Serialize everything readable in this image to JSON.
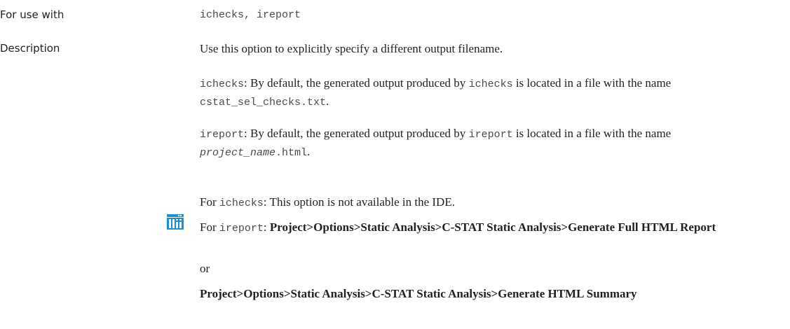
{
  "for_use_with": {
    "label": "For use with",
    "tools": "ichecks, ireport"
  },
  "description": {
    "label": "Description",
    "intro": "Use this option to explicitly specify a different output filename.",
    "ichecks_para": {
      "tool": "ichecks",
      "text1": ": By default, the generated output produced by ",
      "tool2": "ichecks",
      "text2": " is located in a file with the name ",
      "filename": "cstat_sel_checks.txt",
      "end": "."
    },
    "ireport_para": {
      "tool": "ireport",
      "text1": ": By default, the generated output produced by ",
      "tool2": "ireport",
      "text2": " is located in a file with the name ",
      "filename_italic": "project_name",
      "filename_ext": ".html",
      "end": "."
    }
  },
  "ide": {
    "icon": "ide-window-icon",
    "ichecks_prefix": "For ",
    "ichecks_tool": "ichecks",
    "ichecks_text": ": This option is not available in the IDE.",
    "ireport_prefix": "For ",
    "ireport_tool": "ireport",
    "ireport_sep": ": ",
    "ireport_path": "Project>Options>Static Analysis>C-STAT Static Analysis>Generate Full HTML Report",
    "or": "or",
    "summary_path": "Project>Options>Static Analysis>C-STAT Static Analysis>Generate HTML Summary"
  },
  "colors": {
    "text": "#231f20",
    "code": "#4a4a4a",
    "icon_blue": "#1a8fd6"
  }
}
